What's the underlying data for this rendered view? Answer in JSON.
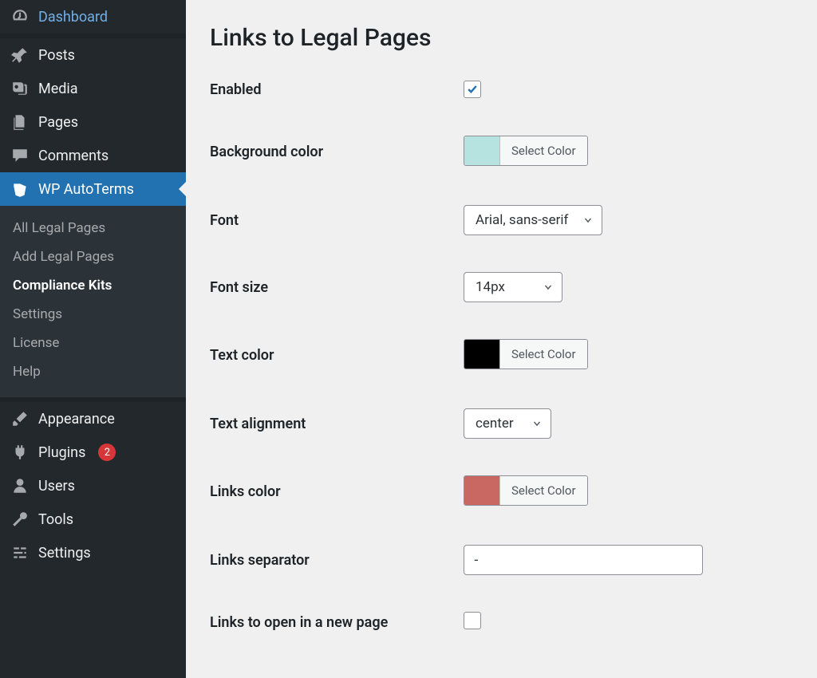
{
  "sidebar": {
    "items": [
      {
        "label": "Dashboard",
        "icon": "gauge-icon"
      },
      {
        "label": "Posts",
        "icon": "pin-icon"
      },
      {
        "label": "Media",
        "icon": "media-icon"
      },
      {
        "label": "Pages",
        "icon": "pages-icon"
      },
      {
        "label": "Comments",
        "icon": "comment-icon"
      },
      {
        "label": "WP AutoTerms",
        "icon": "shield-icon",
        "current": true
      },
      {
        "label": "Appearance",
        "icon": "brush-icon"
      },
      {
        "label": "Plugins",
        "icon": "plug-icon",
        "badge": "2"
      },
      {
        "label": "Users",
        "icon": "user-icon"
      },
      {
        "label": "Tools",
        "icon": "wrench-icon"
      },
      {
        "label": "Settings",
        "icon": "sliders-icon"
      }
    ],
    "submenu": [
      {
        "label": "All Legal Pages"
      },
      {
        "label": "Add Legal Pages"
      },
      {
        "label": "Compliance Kits",
        "active": true
      },
      {
        "label": "Settings"
      },
      {
        "label": "License"
      },
      {
        "label": "Help"
      }
    ]
  },
  "page": {
    "title": "Links to Legal Pages"
  },
  "form": {
    "enabled": {
      "label": "Enabled",
      "checked": true
    },
    "bg_color": {
      "label": "Background color",
      "swatch": "#b6e3e0",
      "button": "Select Color"
    },
    "font": {
      "label": "Font",
      "value": "Arial, sans-serif"
    },
    "font_size": {
      "label": "Font size",
      "value": "14px"
    },
    "text_color": {
      "label": "Text color",
      "swatch": "#000000",
      "button": "Select Color"
    },
    "text_align": {
      "label": "Text alignment",
      "value": "center"
    },
    "links_color": {
      "label": "Links color",
      "swatch": "#c96863",
      "button": "Select Color"
    },
    "links_sep": {
      "label": "Links separator",
      "value": "-"
    },
    "links_new": {
      "label": "Links to open in a new page",
      "checked": false
    }
  }
}
